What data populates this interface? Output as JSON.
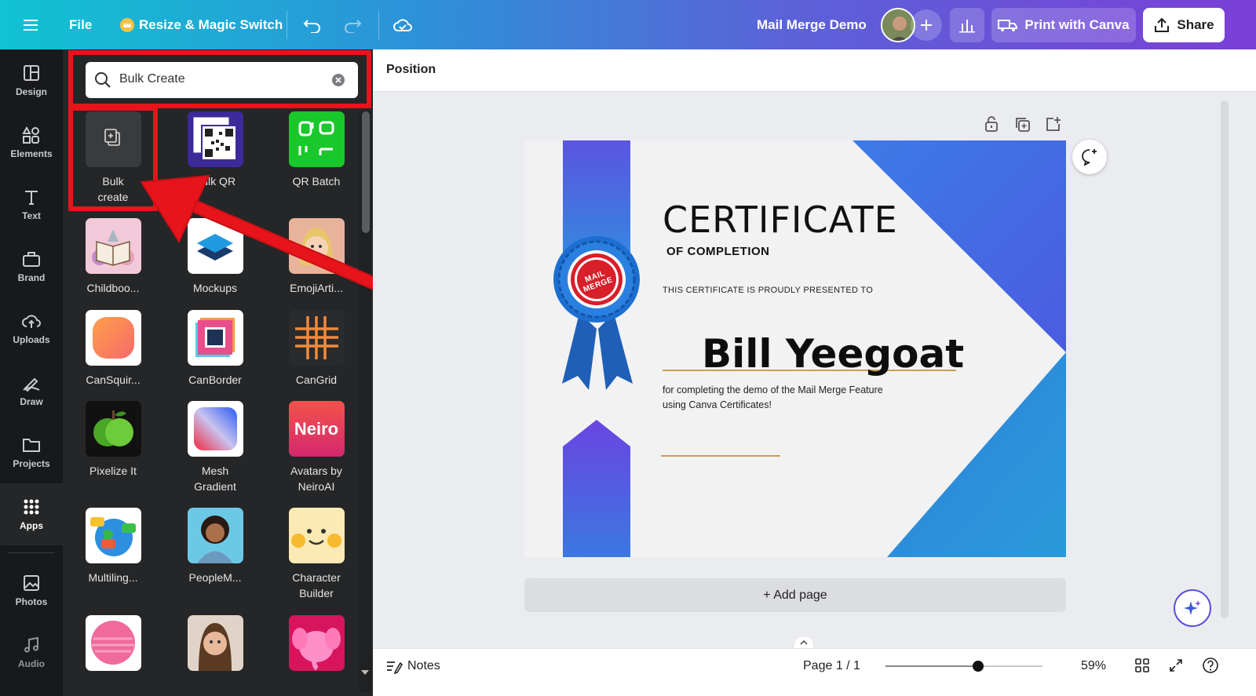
{
  "topbar": {
    "file_label": "File",
    "resize_label": "Resize & Magic Switch",
    "doc_title": "Mail Merge Demo",
    "print_label": "Print with Canva",
    "share_label": "Share"
  },
  "rail": {
    "items": [
      {
        "label": "Design",
        "icon": "layout-icon"
      },
      {
        "label": "Elements",
        "icon": "shapes-icon"
      },
      {
        "label": "Text",
        "icon": "text-icon"
      },
      {
        "label": "Brand",
        "icon": "brand-icon"
      },
      {
        "label": "Uploads",
        "icon": "cloud-upload-icon"
      },
      {
        "label": "Draw",
        "icon": "draw-icon"
      },
      {
        "label": "Projects",
        "icon": "folder-icon"
      },
      {
        "label": "Apps",
        "icon": "apps-grid-icon"
      },
      {
        "label": "Photos",
        "icon": "image-icon"
      },
      {
        "label": "Audio",
        "icon": "music-icon"
      }
    ]
  },
  "search": {
    "value": "Bulk Create"
  },
  "apps": [
    {
      "l1": "Bulk",
      "l2": "create"
    },
    {
      "l1": "Bulk QR",
      "l2": ""
    },
    {
      "l1": "QR Batch",
      "l2": ""
    },
    {
      "l1": "Childboo...",
      "l2": ""
    },
    {
      "l1": "Mockups",
      "l2": ""
    },
    {
      "l1": "EmojiArti...",
      "l2": ""
    },
    {
      "l1": "CanSquir...",
      "l2": ""
    },
    {
      "l1": "CanBorder",
      "l2": ""
    },
    {
      "l1": "CanGrid",
      "l2": ""
    },
    {
      "l1": "Pixelize It",
      "l2": ""
    },
    {
      "l1": "Mesh",
      "l2": "Gradient"
    },
    {
      "l1": "Avatars by",
      "l2": "NeiroAI"
    },
    {
      "l1": "Multiling...",
      "l2": ""
    },
    {
      "l1": "PeopleM...",
      "l2": ""
    },
    {
      "l1": "Character",
      "l2": "Builder"
    }
  ],
  "neiro_tile_text": "Neiro",
  "position_label": "Position",
  "certificate": {
    "title": "CERTIFICATE",
    "subtitle": "OF COMPLETION",
    "presented": "THIS CERTIFICATE IS PROUDLY PRESENTED TO",
    "name": "Bill Yeegoat",
    "desc_line1": "for completing the demo of the Mail Merge Feature",
    "desc_line2": "using Canva Certificates!",
    "stamp_text": "MAIL MERGE"
  },
  "add_page_label": "+ Add page",
  "bottombar": {
    "notes_label": "Notes",
    "page_label": "Page 1 / 1",
    "zoom_label": "59%",
    "zoom_level": 0.59
  },
  "colors": {
    "accent_red": "#e8141b",
    "rail_bg": "#18191b",
    "panel_bg": "#252627",
    "cert_blue": "#3d6fe0",
    "cert_purple": "#6a4fe4",
    "gold_line": "#c9a04a"
  }
}
